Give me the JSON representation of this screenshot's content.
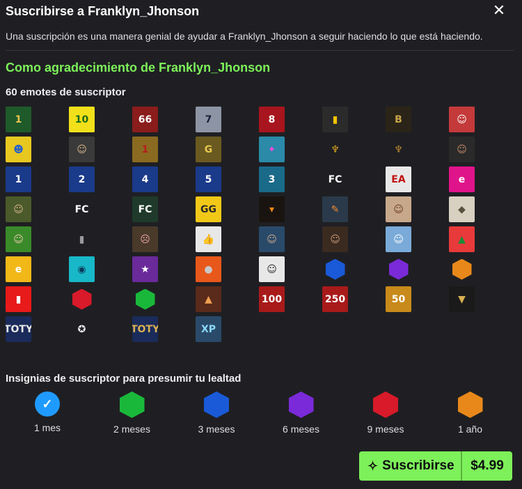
{
  "header": {
    "title": "Suscribirse a Franklyn_Jhonson",
    "close_icon": "close-icon",
    "description": "Una suscripción es una manera genial de ayudar a Franklyn_Jhonson a seguir haciendo lo que está haciendo."
  },
  "thanks": "Como agradecimiento de Franklyn_Jhonson",
  "emotes_title": "60 emotes de suscriptor",
  "emotes": [
    {
      "icon": "gold-coin-1",
      "bg": "#1e5a2a",
      "fg": "#e8c350",
      "text": "1"
    },
    {
      "icon": "yellow-10",
      "bg": "#f2e01a",
      "fg": "#1c6a1a",
      "text": "10"
    },
    {
      "icon": "card-66",
      "bg": "#8a1c1c",
      "fg": "#fff",
      "text": "66"
    },
    {
      "icon": "card-7",
      "bg": "#8d95a5",
      "fg": "#1a1f3a",
      "text": "7"
    },
    {
      "icon": "card-8",
      "bg": "#a8151e",
      "fg": "#fff",
      "text": "8"
    },
    {
      "icon": "yellow-card",
      "bg": "#2b2b2b",
      "fg": "#f5c400",
      "text": "▮"
    },
    {
      "icon": "ballon-dor",
      "bg": "#2a2418",
      "fg": "#c7a54a",
      "text": "B"
    },
    {
      "icon": "player-portrait",
      "bg": "#c43a3a",
      "fg": "#fff",
      "text": "☺"
    },
    {
      "icon": "blue-face",
      "bg": "#e8c820",
      "fg": "#2a62c8",
      "text": "☻"
    },
    {
      "icon": "bald-face",
      "bg": "#3a3a3a",
      "fg": "#d9b38c",
      "text": "☺"
    },
    {
      "icon": "gold-badge-1",
      "bg": "#8a6a20",
      "fg": "#b31d1d",
      "text": "1"
    },
    {
      "icon": "gold-ticket",
      "bg": "#6a5a20",
      "fg": "#e8c850",
      "text": "G"
    },
    {
      "icon": "carnival-mask",
      "bg": "#2a8aa8",
      "fg": "#e84ad8",
      "text": "✦"
    },
    {
      "icon": "world-cup-trophy",
      "bg": "#1f1f23",
      "fg": "#d9a520",
      "text": "♆"
    },
    {
      "icon": "world-cup-trophy-2",
      "bg": "#1f1f23",
      "fg": "#b8892a",
      "text": "♆"
    },
    {
      "icon": "ronaldo-portrait",
      "bg": "#2a2a2a",
      "fg": "#c48a6a",
      "text": "☺"
    },
    {
      "icon": "division-1-badge",
      "bg": "#1a3a8a",
      "fg": "#fff",
      "text": "1"
    },
    {
      "icon": "division-2-badge",
      "bg": "#1a3a8a",
      "fg": "#fff",
      "text": "2"
    },
    {
      "icon": "division-4-badge",
      "bg": "#1a3a8a",
      "fg": "#fff",
      "text": "4"
    },
    {
      "icon": "division-5-badge",
      "bg": "#1a3a8a",
      "fg": "#fff",
      "text": "5"
    },
    {
      "icon": "division-3-badge",
      "bg": "#1a6a8a",
      "fg": "#fff",
      "text": "3"
    },
    {
      "icon": "fc-logo",
      "bg": "#1f1f23",
      "fg": "#fff",
      "text": "FC"
    },
    {
      "icon": "ea-sports-logo",
      "bg": "#e8e8e8",
      "fg": "#c01010",
      "text": "EA"
    },
    {
      "icon": "efootball-logo",
      "bg": "#e0148a",
      "fg": "#fff",
      "text": "e"
    },
    {
      "icon": "player-face",
      "bg": "#4a5a2a",
      "fg": "#d9b38c",
      "text": "☺"
    },
    {
      "icon": "fc-mobile-logo",
      "bg": "#1f1f23",
      "fg": "#fff",
      "text": "FC"
    },
    {
      "icon": "fc-green-badge",
      "bg": "#1f3a2a",
      "fg": "#fff",
      "text": "FC"
    },
    {
      "icon": "gg-emoji",
      "bg": "#f2c818",
      "fg": "#2a2a2a",
      "text": "GG"
    },
    {
      "icon": "pumpkin-face",
      "bg": "#1a1410",
      "fg": "#f08a10",
      "text": "▾"
    },
    {
      "icon": "orange-boot",
      "bg": "#2a3a4a",
      "fg": "#f08a30",
      "text": "✎"
    },
    {
      "icon": "player-face-2",
      "bg": "#c8a88a",
      "fg": "#6a3a2a",
      "text": "☺"
    },
    {
      "icon": "white-badge",
      "bg": "#d8d0c0",
      "fg": "#5a5040",
      "text": "◆"
    },
    {
      "icon": "laughing-face",
      "bg": "#3a8a2a",
      "fg": "#e8c8a8",
      "text": "☺"
    },
    {
      "icon": "bar-chart-icon",
      "bg": "#1f1f23",
      "fg": "#9a9a9a",
      "text": "▮"
    },
    {
      "icon": "facepalm-face",
      "bg": "#4a3a2a",
      "fg": "#e8a8a8",
      "text": "☹"
    },
    {
      "icon": "thumbs-up",
      "bg": "#e8e8e8",
      "fg": "#d81818",
      "text": "👍"
    },
    {
      "icon": "player-blue",
      "bg": "#2a4a6a",
      "fg": "#c8a88a",
      "text": "☺"
    },
    {
      "icon": "messi-face",
      "bg": "#3a2a20",
      "fg": "#c89a7a",
      "text": "☺"
    },
    {
      "icon": "messi-celebrating",
      "bg": "#7aaad8",
      "fg": "#fff",
      "text": "☺"
    },
    {
      "icon": "christmas-tree",
      "bg": "#e83a3a",
      "fg": "#1a8a3a",
      "text": "▲"
    },
    {
      "icon": "efootball-coin",
      "bg": "#f2b818",
      "fg": "#fff",
      "text": "e"
    },
    {
      "icon": "stadium-ball",
      "bg": "#18b8c8",
      "fg": "#0a3a5a",
      "text": "◉"
    },
    {
      "icon": "purple-pentagon-star",
      "bg": "#6a2a9a",
      "fg": "#fff",
      "text": "★"
    },
    {
      "icon": "grey-ball",
      "bg": "#e8581a",
      "fg": "#c8c8c8",
      "text": "●"
    },
    {
      "icon": "clock-face",
      "bg": "#e8e8e8",
      "fg": "#2a2a2a",
      "text": "☺"
    },
    {
      "icon": "blue-hexagon",
      "bg": "#1f1f23",
      "fg": "#1a5ad8",
      "text": "hex"
    },
    {
      "icon": "purple-hexagon",
      "bg": "#1f1f23",
      "fg": "#7a2ad8",
      "text": "hex"
    },
    {
      "icon": "orange-hexagon",
      "bg": "#1f1f23",
      "fg": "#e8881a",
      "text": "hex"
    },
    {
      "icon": "red-card",
      "bg": "#e81a1a",
      "fg": "#fff",
      "text": "▮"
    },
    {
      "icon": "red-hexagon",
      "bg": "#1f1f23",
      "fg": "#d81a2a",
      "text": "hex"
    },
    {
      "icon": "green-hexagon",
      "bg": "#1f1f23",
      "fg": "#1ab83a",
      "text": "hex"
    },
    {
      "icon": "orange-triangle",
      "bg": "#5a2a1a",
      "fg": "#f0a050",
      "text": "▲"
    },
    {
      "icon": "card-100",
      "bg": "#a81a1a",
      "fg": "#fff",
      "text": "100"
    },
    {
      "icon": "card-250",
      "bg": "#a81a1a",
      "fg": "#fff",
      "text": "250"
    },
    {
      "icon": "card-50",
      "bg": "#c88a1a",
      "fg": "#fff",
      "text": "50"
    },
    {
      "icon": "trophy-coin",
      "bg": "#1a1a1a",
      "fg": "#d8b050",
      "text": "▼"
    },
    {
      "icon": "toty-badge",
      "bg": "#1a2a5a",
      "fg": "#e8e8e8",
      "text": "TOTY"
    },
    {
      "icon": "champions-league-ball",
      "bg": "#1f1f23",
      "fg": "#fff",
      "text": "✪"
    },
    {
      "icon": "toty-card",
      "bg": "#1a2a5a",
      "fg": "#d8b050",
      "text": "TOTY"
    },
    {
      "icon": "xp-badge",
      "bg": "#2a4a6a",
      "fg": "#8ad8f8",
      "text": "XP"
    }
  ],
  "badges_title": "Insignias de suscriptor para presumir tu lealtad",
  "badges": [
    {
      "label": "1 mes",
      "color": "#1f9bff",
      "icon": "verified-check-icon"
    },
    {
      "label": "2 meses",
      "color": "#1ab83a",
      "icon": "green-hexagon-icon"
    },
    {
      "label": "3 meses",
      "color": "#1a5ad8",
      "icon": "blue-hexagon-icon"
    },
    {
      "label": "6 meses",
      "color": "#7a2ad8",
      "icon": "purple-hexagon-icon"
    },
    {
      "label": "9 meses",
      "color": "#d81a2a",
      "icon": "red-hexagon-icon"
    },
    {
      "label": "1 año",
      "color": "#e8881a",
      "icon": "orange-hexagon-icon"
    }
  ],
  "subscribe": {
    "label": "Suscribirse",
    "price": "$4.99",
    "icon": "sparkle-icon",
    "color": "#7df15a"
  }
}
